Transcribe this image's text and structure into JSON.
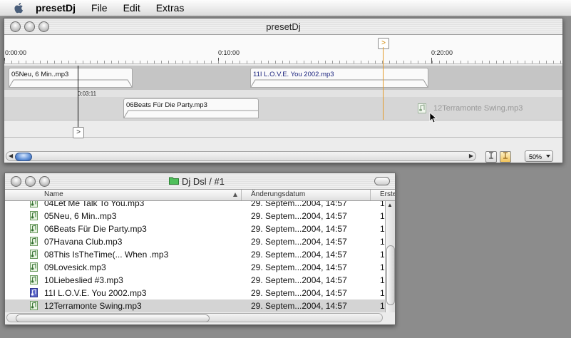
{
  "menubar": {
    "app_name": "presetDj",
    "items": [
      "File",
      "Edit",
      "Extras"
    ]
  },
  "main_window": {
    "title": "presetDj",
    "ruler_labels": [
      "0:00:00",
      "0:10:00",
      "0:20:00"
    ],
    "marker_glyph": ">",
    "cursor_time": "0:03:11",
    "clips": [
      {
        "label": "05Neu, 6 Min..mp3",
        "track": 1
      },
      {
        "label": "11I L.O.V.E. You 2002.mp3",
        "track": 1
      },
      {
        "label": "06Beats Für Die Party.mp3",
        "track": 2
      }
    ],
    "dragged_clip": "12Terramonte Swing.mp3",
    "zoom": "50%",
    "colors": {
      "playhead": "#e39b2a",
      "clip_title_blue": "#1a237e"
    }
  },
  "file_window": {
    "title": "Dj Dsl / #1",
    "columns": {
      "name": "Name",
      "date": "Änderungsdatum",
      "created": "Erste"
    },
    "rows": [
      {
        "name": "04Let Me Talk To You.mp3",
        "date": "29. Septem...2004, 14:57",
        "extra": "1",
        "icon": "music-file-icon"
      },
      {
        "name": "05Neu, 6 Min..mp3",
        "date": "29. Septem...2004, 14:57",
        "extra": "1",
        "icon": "music-file-icon"
      },
      {
        "name": "06Beats Für Die Party.mp3",
        "date": "29. Septem...2004, 14:57",
        "extra": "1",
        "icon": "music-file-icon"
      },
      {
        "name": "07Havana Club.mp3",
        "date": "29. Septem...2004, 14:57",
        "extra": "1",
        "icon": "music-file-icon"
      },
      {
        "name": "08This IsTheTime(... When .mp3",
        "date": "29. Septem...2004, 14:57",
        "extra": "1",
        "icon": "music-file-icon"
      },
      {
        "name": "09Lovesick.mp3",
        "date": "29. Septem...2004, 14:57",
        "extra": "1",
        "icon": "music-file-icon"
      },
      {
        "name": "10Liebeslied #3.mp3",
        "date": "29. Septem...2004, 14:57",
        "extra": "1",
        "icon": "music-file-icon"
      },
      {
        "name": "11I L.O.V.E. You 2002.mp3",
        "date": "29. Septem...2004, 14:57",
        "extra": "1",
        "icon": "music-file-blue-icon"
      },
      {
        "name": "12Terramonte Swing.mp3",
        "date": "29. Septem...2004, 14:57",
        "extra": "1",
        "icon": "music-file-icon",
        "selected": true
      }
    ]
  }
}
